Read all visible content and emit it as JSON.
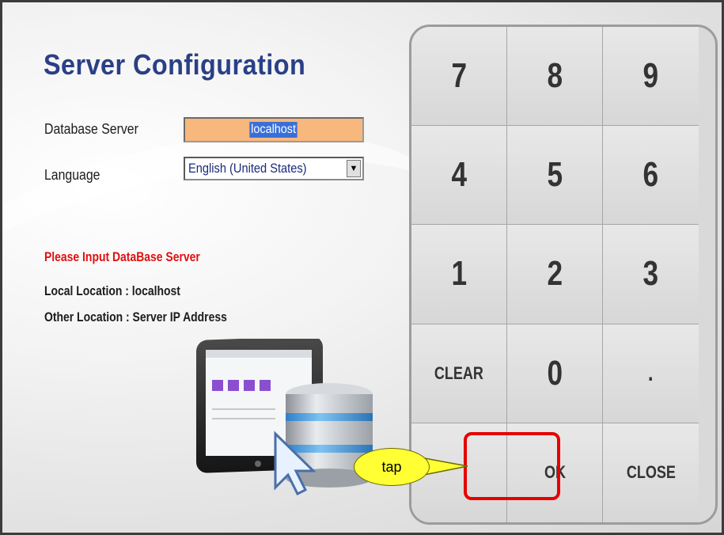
{
  "title": "Server Configuration",
  "fields": {
    "database_server_label": "Database Server",
    "database_server_value": "localhost",
    "language_label": "Language",
    "language_value": "English (United States)"
  },
  "hints": {
    "warning": "Please Input DataBase Server",
    "local": "Local Location : localhost",
    "other": "Other Location : Server IP Address"
  },
  "keypad": {
    "keys": [
      "7",
      "8",
      "9",
      "4",
      "5",
      "6",
      "1",
      "2",
      "3",
      "CLEAR",
      "0",
      ".",
      "",
      "OK",
      "CLOSE"
    ]
  },
  "callout": {
    "text": "tap"
  },
  "colors": {
    "title": "#2a3f86",
    "warning": "#e01010",
    "input_bg": "#f7b77d",
    "highlight": "#e60000",
    "callout": "#ffff33"
  }
}
